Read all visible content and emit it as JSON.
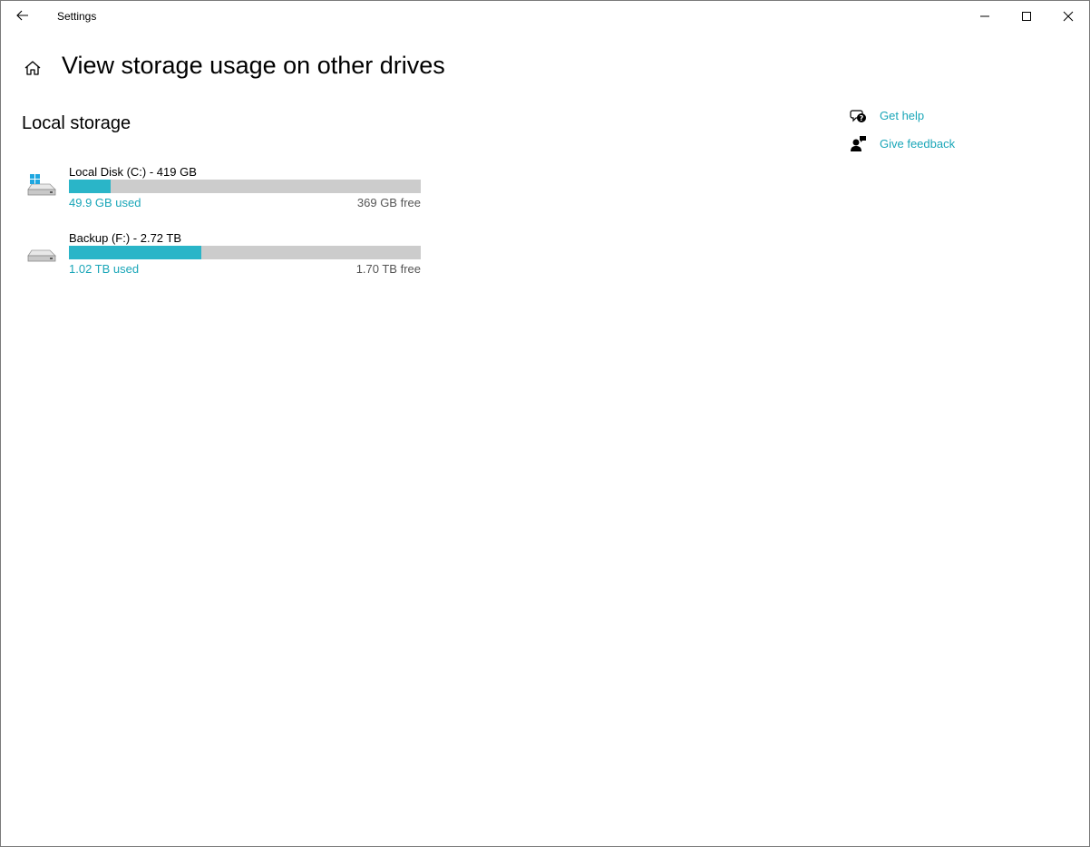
{
  "window": {
    "title": "Settings"
  },
  "header": {
    "title": "View storage usage on other drives"
  },
  "section": {
    "title": "Local storage"
  },
  "drives": [
    {
      "name": "Local Disk (C:) - 419 GB",
      "used": "49.9 GB used",
      "free": "369 GB free",
      "used_fraction": 0.119,
      "icon": "system-drive-icon"
    },
    {
      "name": "Backup (F:) - 2.72 TB",
      "used": "1.02 TB used",
      "free": "1.70 TB free",
      "used_fraction": 0.375,
      "icon": "drive-icon"
    }
  ],
  "links": {
    "help": "Get help",
    "feedback": "Give feedback"
  },
  "colors": {
    "accent": "#2ab5c8",
    "link": "#1aa6b8",
    "bar_track": "#cccccc"
  }
}
